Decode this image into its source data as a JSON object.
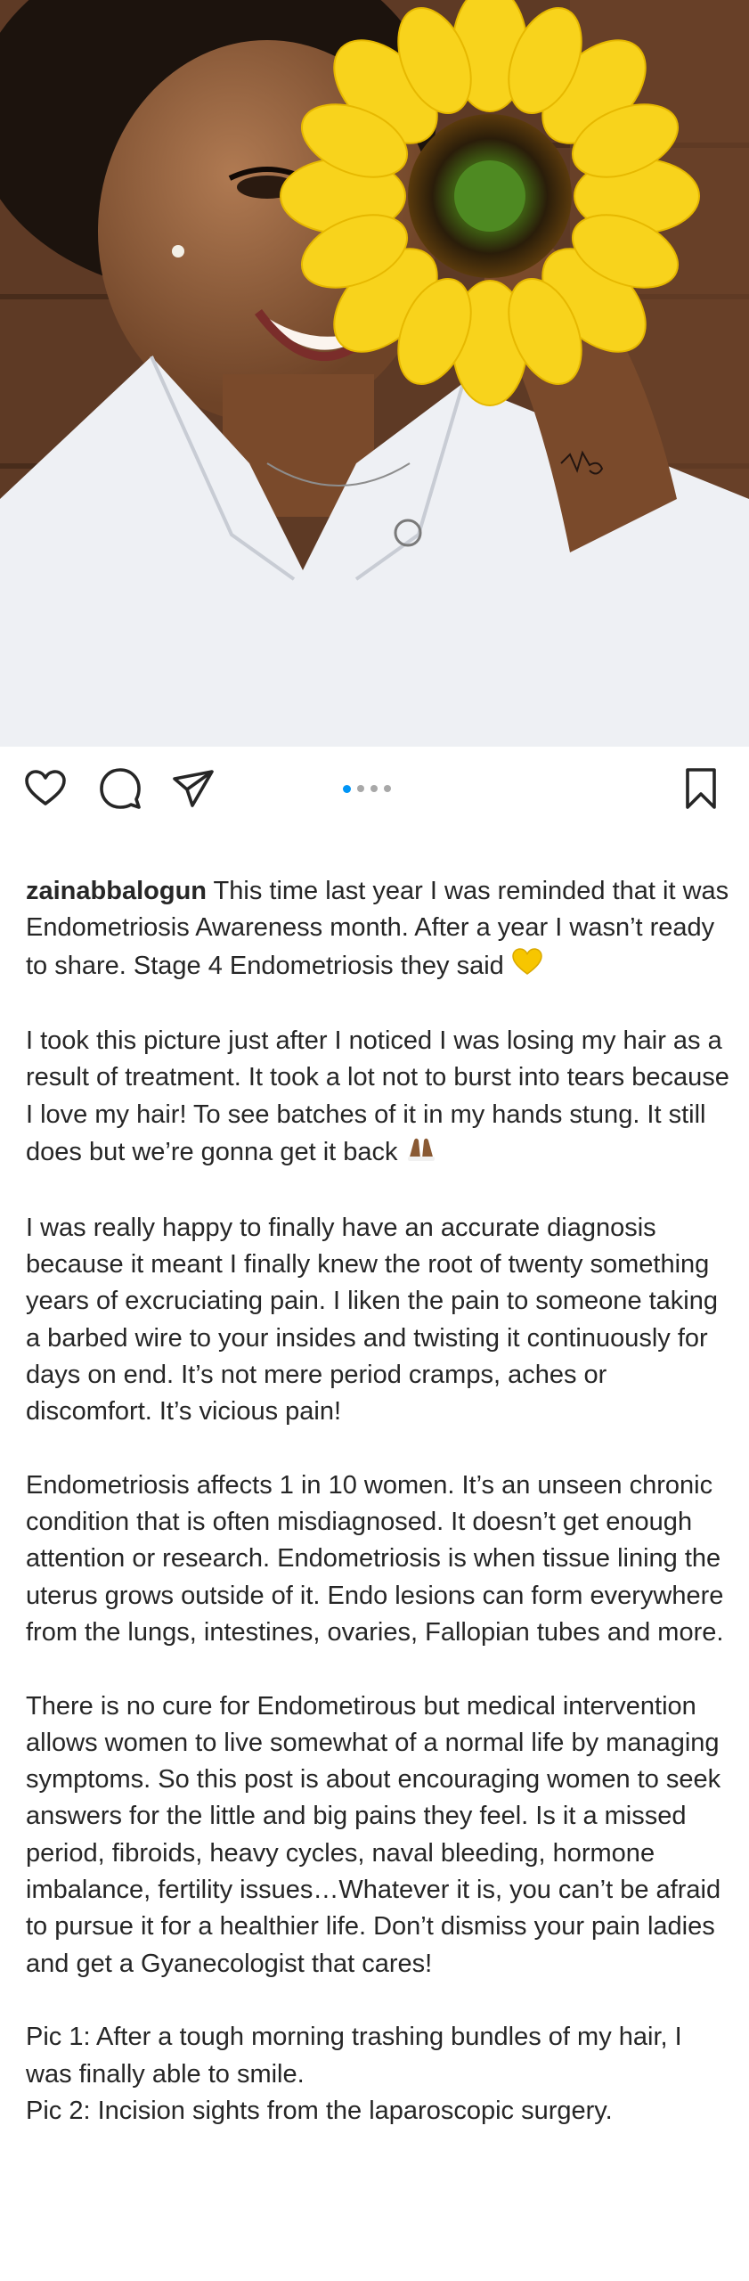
{
  "post": {
    "image_description_icon": "photo-woman-sunflower",
    "carousel": {
      "count": 4,
      "active_index": 0
    },
    "actions": {
      "like_icon": "heart-icon",
      "comment_icon": "comment-icon",
      "share_icon": "share-icon",
      "save_icon": "bookmark-icon"
    },
    "caption": {
      "username": "zainabbalogun",
      "p1": "This time last year I was reminded that it was Endometriosis Awareness month. After a year I wasn’t ready to share. Stage 4 Endometriosis they said",
      "p2": " I took this picture just after I noticed I was losing my hair as a result of treatment. It took a lot not to burst into tears because I love my hair! To see batches of it in my hands stung. It still does but we’re gonna get it back",
      "p3": "I was really happy to finally have an accurate diagnosis because it meant I finally knew the root of twenty something years of excruciating pain. I liken the pain to someone taking a barbed wire to your insides and twisting it continuously for days on end. It’s not mere period cramps, aches or discomfort. It’s vicious pain!",
      "p4": "Endometriosis affects 1 in 10 women. It’s an unseen chronic condition that is often misdiagnosed. It doesn’t get enough attention or research. Endometriosis is when tissue lining the uterus grows outside of it. Endo lesions can form everywhere from the lungs, intestines, ovaries, Fallopian tubes and more.",
      "p5": "There is no cure for Endometirous but medical intervention allows women to live somewhat of a normal life by managing symptoms.  So this post is about encouraging women to seek answers for the little and big pains they feel. Is it a missed period, fibroids, heavy cycles, naval bleeding, hormone imbalance, fertility issues…Whatever it is, you can’t be afraid to pursue it for a healthier life. Don’t dismiss your pain ladies and get a Gyanecologist that cares!",
      "p6_line1": "Pic 1: After a tough morning trashing bundles of my hair, I was finally able to smile.",
      "p6_line2": "Pic 2: Incision sights from the laparoscopic surgery."
    },
    "colors": {
      "accent": "#0095f6",
      "text": "#262626",
      "dot_inactive": "#a8a8a8",
      "heart_emoji": "#f7c600",
      "hands_emoji": "#8a5a34"
    }
  }
}
